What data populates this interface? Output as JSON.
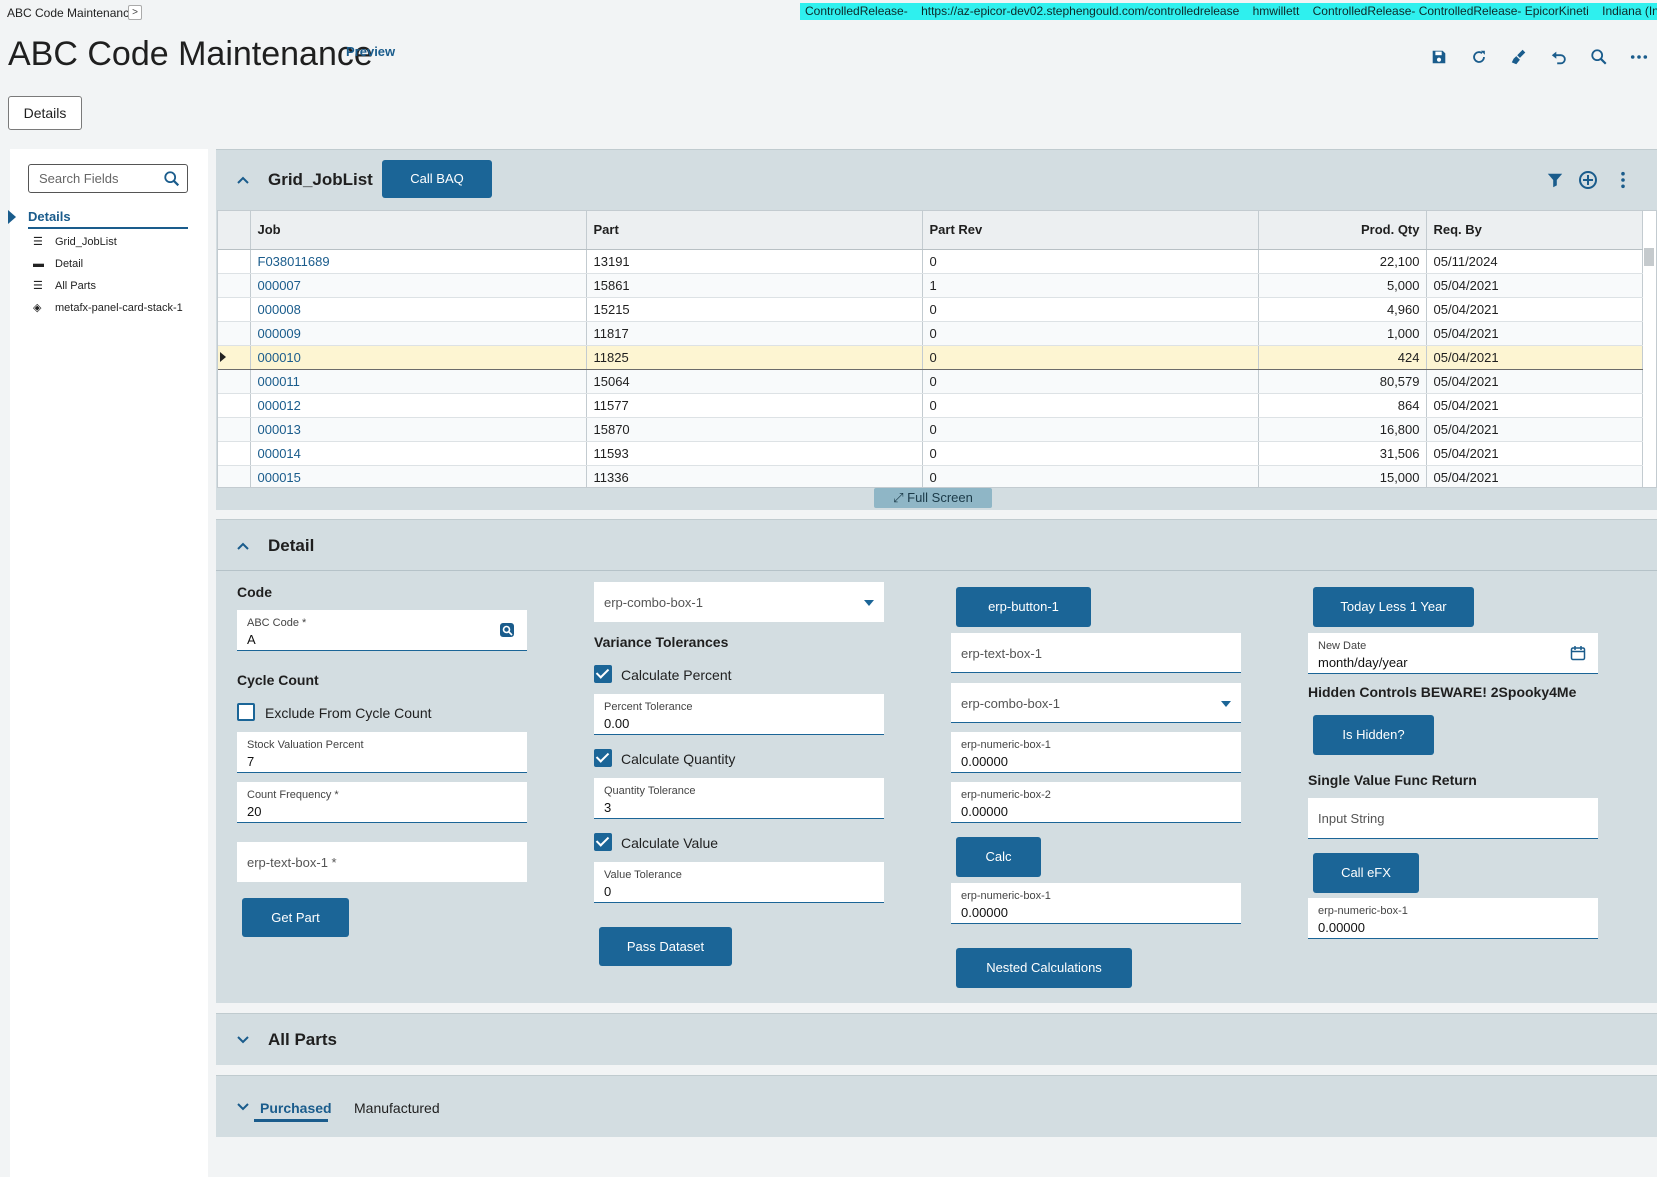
{
  "breadcrumb": {
    "app": "ABC Code Maintenance",
    "expand": ">"
  },
  "env": {
    "items": [
      "ControlledRelease-",
      "https://az-epicor-dev02.stephengould.com/controlledrelease",
      "hmwillett",
      "ControlledRelease- ControlledRelease- EpicorKineti",
      "Indiana (Indianapolis"
    ]
  },
  "page": {
    "title": "ABC Code Maintenance",
    "badge": "Preview"
  },
  "toolbar": {
    "icons": [
      "save-icon",
      "refresh-icon",
      "clear-icon",
      "undo-icon",
      "search-icon",
      "more-icon"
    ]
  },
  "details_button": "Details",
  "sidebar": {
    "search_placeholder": "Search Fields",
    "section": "Details",
    "items": [
      {
        "label": "Grid_JobList",
        "icon": "list-icon"
      },
      {
        "label": "Detail",
        "icon": "card-icon"
      },
      {
        "label": "All Parts",
        "icon": "list-icon"
      },
      {
        "label": "metafx-panel-card-stack-1",
        "icon": "layers-icon"
      }
    ]
  },
  "grid_panel": {
    "title": "Grid_JobList",
    "call_baq": "Call BAQ",
    "columns": [
      "Job",
      "Part",
      "Part Rev",
      "Prod. Qty",
      "Req. By"
    ],
    "rows": [
      [
        "F038011689",
        "13191",
        "0",
        "22,100",
        "05/11/2024"
      ],
      [
        "000007",
        "15861",
        "1",
        "5,000",
        "05/04/2021"
      ],
      [
        "000008",
        "15215",
        "0",
        "4,960",
        "05/04/2021"
      ],
      [
        "000009",
        "11817",
        "0",
        "1,000",
        "05/04/2021"
      ],
      [
        "000010",
        "11825",
        "0",
        "424",
        "05/04/2021"
      ],
      [
        "000011",
        "15064",
        "0",
        "80,579",
        "05/04/2021"
      ],
      [
        "000012",
        "11577",
        "0",
        "864",
        "05/04/2021"
      ],
      [
        "000013",
        "15870",
        "0",
        "16,800",
        "05/04/2021"
      ],
      [
        "000014",
        "11593",
        "0",
        "31,506",
        "05/04/2021"
      ],
      [
        "000015",
        "11336",
        "0",
        "15,000",
        "05/04/2021"
      ]
    ],
    "full_screen": "Full Screen"
  },
  "detail": {
    "title": "Detail",
    "code_label": "Code",
    "abc_code": {
      "label": "ABC Code *",
      "value": "A"
    },
    "cycle_count_label": "Cycle Count",
    "exclude_label": "Exclude From Cycle Count",
    "stock_val": {
      "label": "Stock Valuation Percent",
      "value": "7"
    },
    "count_freq": {
      "label": "Count Frequency *",
      "value": "20"
    },
    "text_box_1": "erp-text-box-1 *",
    "get_part": "Get Part",
    "combo_1": "erp-combo-box-1",
    "variance_label": "Variance Tolerances",
    "calc_percent": "Calculate Percent",
    "percent_tol": {
      "label": "Percent Tolerance",
      "value": "0.00"
    },
    "calc_qty": "Calculate Quantity",
    "qty_tol": {
      "label": "Quantity Tolerance",
      "value": "3"
    },
    "calc_value": "Calculate Value",
    "value_tol": {
      "label": "Value Tolerance",
      "value": "0"
    },
    "pass_dataset": "Pass Dataset",
    "erp_button_1": "erp-button-1",
    "erp_text_box_1": "erp-text-box-1",
    "erp_combo_box_1": "erp-combo-box-1",
    "numeric_1": {
      "label": "erp-numeric-box-1",
      "value": "0.00000"
    },
    "numeric_2": {
      "label": "erp-numeric-box-2",
      "value": "0.00000"
    },
    "calc": "Calc",
    "numeric_3": {
      "label": "erp-numeric-box-1",
      "value": "0.00000"
    },
    "nested_calc": "Nested Calculations",
    "today_less": "Today Less 1 Year",
    "new_date": {
      "label": "New Date",
      "value": "month/day/year"
    },
    "hidden_label": "Hidden Controls BEWARE! 2Spooky4Me",
    "is_hidden": "Is Hidden?",
    "single_value": "Single Value Func Return",
    "input_string": "Input String",
    "call_efx": "Call eFX",
    "numeric_4": {
      "label": "erp-numeric-box-1",
      "value": "0.00000"
    }
  },
  "all_parts": {
    "title": "All Parts"
  },
  "tabs": {
    "purchased": "Purchased",
    "manufactured": "Manufactured"
  },
  "colors": {
    "accent": "#1b6597",
    "env_bar": "#2ff0ee",
    "panel": "#d3dde1",
    "selected_row": "#fdf5d2"
  }
}
